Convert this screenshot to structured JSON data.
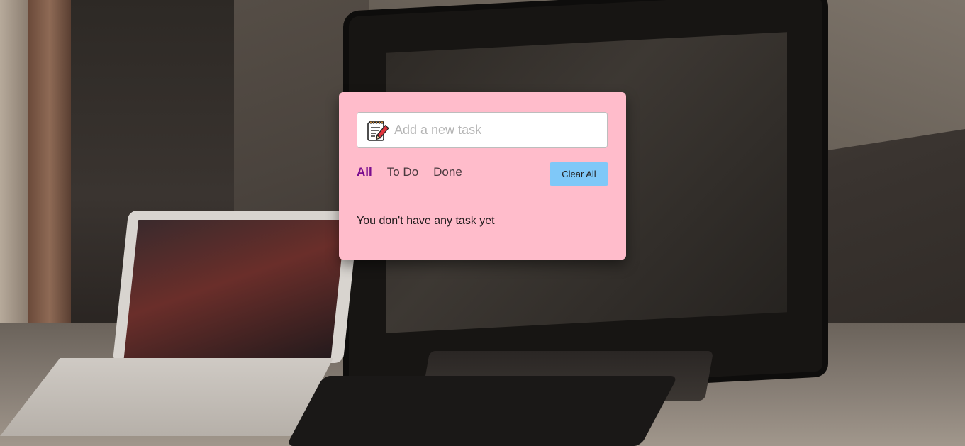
{
  "todo": {
    "input": {
      "placeholder": "Add a new task",
      "value": "",
      "icon": "notepad-icon"
    },
    "filters": [
      {
        "label": "All",
        "active": true
      },
      {
        "label": "To Do",
        "active": false
      },
      {
        "label": "Done",
        "active": false
      }
    ],
    "clear_label": "Clear All",
    "empty_message": "You don't have any task yet"
  },
  "colors": {
    "card_bg": "#ffbccb",
    "active_filter": "#7a0d8f",
    "clear_button": "#7fc8f8"
  }
}
